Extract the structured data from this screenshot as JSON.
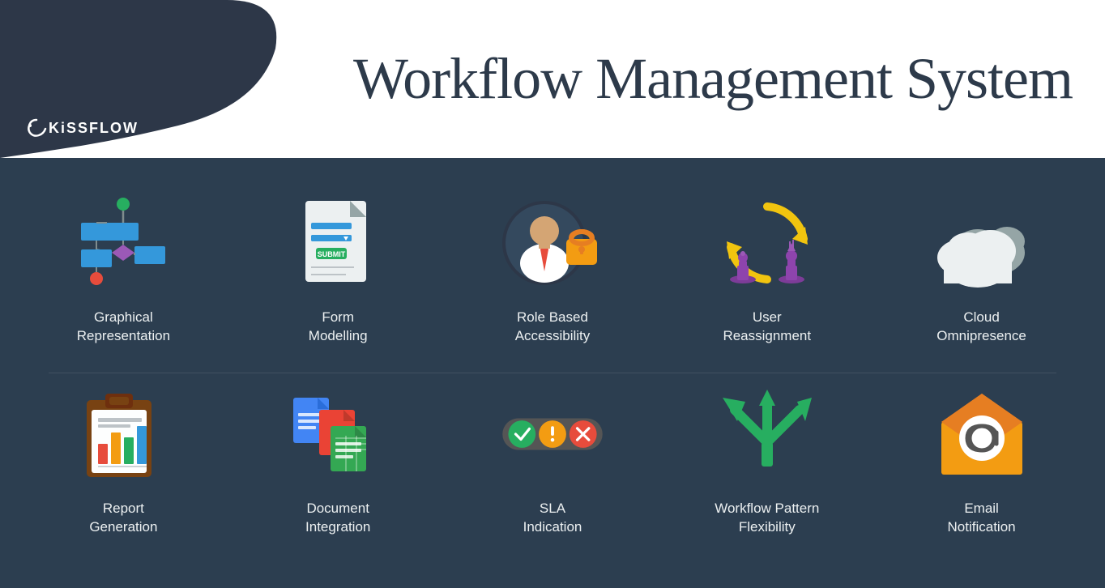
{
  "header": {
    "title": "Workflow Management System",
    "logo": "KiSSFLOW"
  },
  "colors": {
    "bg": "#2d3748",
    "header_bg": "#ffffff",
    "text_light": "#ecf0f1",
    "accent_blue": "#3498db"
  },
  "rows": [
    {
      "items": [
        {
          "id": "graphical-representation",
          "label": "Graphical\nRepresentation"
        },
        {
          "id": "form-modelling",
          "label": "Form\nModelling"
        },
        {
          "id": "role-based-accessibility",
          "label": "Role Based\nAccessibility"
        },
        {
          "id": "user-reassignment",
          "label": "User\nReassignment"
        },
        {
          "id": "cloud-omnipresence",
          "label": "Cloud\nOmnipresence"
        }
      ]
    },
    {
      "items": [
        {
          "id": "report-generation",
          "label": "Report\nGeneration"
        },
        {
          "id": "document-integration",
          "label": "Document\nIntegration"
        },
        {
          "id": "sla-indication",
          "label": "SLA\nIndication"
        },
        {
          "id": "workflow-pattern-flexibility",
          "label": "Workflow Pattern\nFlexibility"
        },
        {
          "id": "email-notification",
          "label": "Email\nNotification"
        }
      ]
    }
  ]
}
